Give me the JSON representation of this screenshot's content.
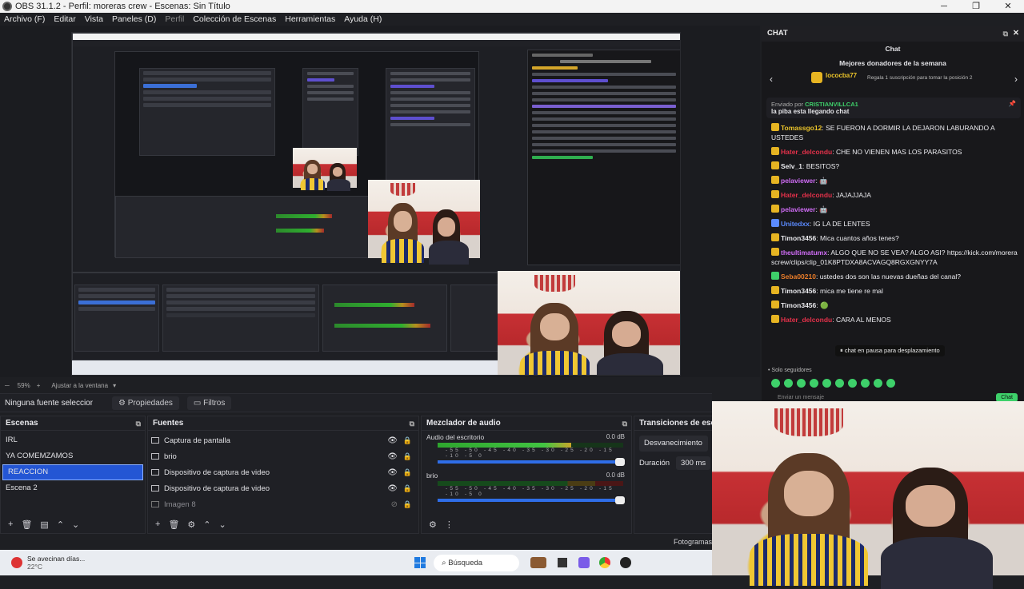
{
  "window": {
    "title": "OBS 31.1.2 - Perfil: moreras crew - Escenas: Sin Título",
    "minimize": "─",
    "maximize": "❐",
    "close": "✕"
  },
  "menu": [
    "Archivo (F)",
    "Editar",
    "Vista",
    "Paneles (D)",
    "Perfil",
    "Colección de Escenas",
    "Herramientas",
    "Ayuda (H)"
  ],
  "preview": {
    "zoom_label": "59%",
    "fit_label": "Ajustar a la ventana"
  },
  "properties_bar": {
    "selection": "Ninguna fuente seleccionada",
    "properties_tab": "Propiedades",
    "filters_tab": "Filtros"
  },
  "scenes": {
    "title": "Escenas",
    "items": [
      "IRL",
      "YA COMEMZAMOS",
      "REACCION",
      "Escena 2"
    ],
    "selected_index": 2
  },
  "sources": {
    "title": "Fuentes",
    "items": [
      {
        "label": "Captura de pantalla",
        "visible": true
      },
      {
        "label": "brio",
        "visible": true
      },
      {
        "label": "Dispositivo de captura de video",
        "visible": true
      },
      {
        "label": "Dispositivo de captura de video",
        "visible": true
      },
      {
        "label": "Imagen 8",
        "visible": false
      }
    ]
  },
  "mixer": {
    "title": "Mezclador de audio",
    "channels": [
      {
        "name": "Audio del escritorio",
        "db": "0.0 dB",
        "level": 0.72
      },
      {
        "name": "brio",
        "db": "0.0 dB",
        "level": 0.0
      }
    ],
    "scale": "-55 -50 -45 -40 -35 -30 -25 -20 -15 -10 -5 0"
  },
  "transitions": {
    "title": "Transiciones de escena",
    "selected": "Desvanecimiento",
    "duration_label": "Duración",
    "duration_value": "300 ms"
  },
  "status": {
    "frames_label": "Fotogramas"
  },
  "taskbar": {
    "weather_text": "Se avecinan días...",
    "temperature": "22°C",
    "search_placeholder": "Búsqueda"
  },
  "chat": {
    "dock_title": "CHAT",
    "header": "Chat",
    "top_donors_title": "Mejores donadores de la semana",
    "top_donor_name": "lococba77",
    "top_donor_note": "Regala 1 suscripción para tomar la posición 2",
    "pinned_prefix": "Enviado por",
    "pinned_user": "CRISTIANVILLCA1",
    "pinned_message": "la piba esta llegando chat",
    "messages": [
      {
        "user": "Tomassgo12",
        "color": "yellow",
        "text": "SE FUERON A DORMIR LA DEJARON LABURANDO A USTEDES"
      },
      {
        "user": "Hater_delcondu",
        "color": "red",
        "text": "CHE NO VIENEN MAS LOS PARASITOS"
      },
      {
        "user": "Selv_1",
        "color": "white",
        "text": "BESITOS?"
      },
      {
        "user": "pelaviewer",
        "color": "purple",
        "text": "🤖"
      },
      {
        "user": "Hater_delcondu",
        "color": "red",
        "text": "JAJAJJAJA"
      },
      {
        "user": "pelaviewer",
        "color": "purple",
        "text": "🤖"
      },
      {
        "user": "Unitedxx",
        "color": "blue",
        "text": "IG LA DE LENTES"
      },
      {
        "user": "Timon3456",
        "color": "white",
        "text": "Mica cuantos años tenes?"
      },
      {
        "user": "theultimatumx",
        "color": "purple",
        "text": "ALGO QUE NO SE VEA? ALGO ASI? https://kick.com/morerascrew/clips/clip_01K8PTDXA8ACVAGQ8RGXGNYY7A"
      },
      {
        "user": "Seba00210",
        "color": "orange",
        "text": "ustedes dos son las nuevas dueñas del canal?"
      },
      {
        "user": "Timon3456",
        "color": "white",
        "text": "mica me tiene re mal"
      },
      {
        "user": "Timon3456",
        "color": "white",
        "text": "🟢"
      },
      {
        "user": "Hater_delcondu",
        "color": "red",
        "text": "CARA AL MENOS"
      }
    ],
    "paused_notice": "chat en pausa para desplazamiento",
    "followers_only": "Solo seguidores",
    "input_placeholder": "Enviar un mensaje",
    "send_label": "Chat"
  }
}
